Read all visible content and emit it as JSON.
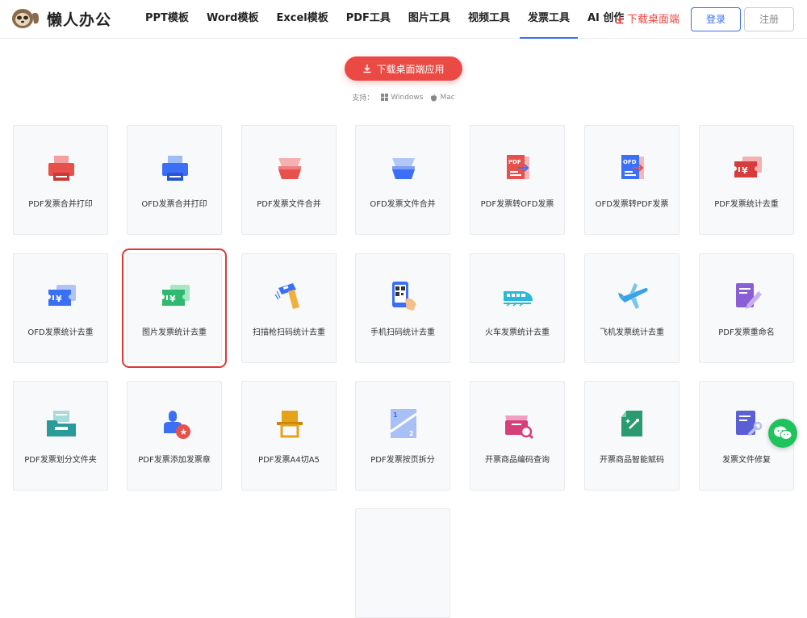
{
  "header": {
    "logo_text": "懒人办公",
    "nav": [
      "PPT模板",
      "Word模板",
      "Excel模板",
      "PDF工具",
      "图片工具",
      "视频工具",
      "发票工具",
      "AI 创作"
    ],
    "active_nav": "发票工具",
    "download_link": "下载桌面端",
    "login": "登录",
    "register": "注册"
  },
  "hero": {
    "download_button": "下载桌面端应用",
    "support_label": "支持：",
    "os": [
      "Windows",
      "Mac"
    ]
  },
  "tools": [
    {
      "label": "PDF发票合并打印",
      "icon": "printer-icon",
      "color": "#e8504b"
    },
    {
      "label": "OFD发票合并打印",
      "icon": "printer-icon",
      "color": "#3b6ff5"
    },
    {
      "label": "PDF发票文件合并",
      "icon": "merge-pages-icon",
      "color": "#e8504b"
    },
    {
      "label": "OFD发票文件合并",
      "icon": "merge-pages-icon",
      "color": "#3b6ff5"
    },
    {
      "label": "PDF发票转OFD发票",
      "icon": "pdf-to-ofd-icon",
      "color": "#e8504b"
    },
    {
      "label": "OFD发票转PDF发票",
      "icon": "ofd-to-pdf-icon",
      "color": "#3b6ff5"
    },
    {
      "label": "PDF发票统计去重",
      "icon": "yen-ticket-icon",
      "color": "#d63c3c"
    },
    {
      "label": "OFD发票统计去重",
      "icon": "yen-ticket-icon",
      "color": "#3b6ff5"
    },
    {
      "label": "图片发票统计去重",
      "icon": "yen-ticket-icon",
      "color": "#2fb86f"
    },
    {
      "label": "扫描枪扫码统计去重",
      "icon": "scanner-gun-icon",
      "color": "#3b6ff5"
    },
    {
      "label": "手机扫码统计去重",
      "icon": "phone-qr-icon",
      "color": "#3b6ff5"
    },
    {
      "label": "火车发票统计去重",
      "icon": "train-icon",
      "color": "#2ab8d8"
    },
    {
      "label": "飞机发票统计去重",
      "icon": "airplane-icon",
      "color": "#3aa3e8"
    },
    {
      "label": "PDF发票重命名",
      "icon": "edit-document-icon",
      "color": "#8a5fd6"
    },
    {
      "label": "PDF发票划分文件夹",
      "icon": "folder-tray-icon",
      "color": "#2a9a9a"
    },
    {
      "label": "PDF发票添加发票章",
      "icon": "stamp-icon",
      "color": "#3b6ff5"
    },
    {
      "label": "PDF发票A4切A5",
      "icon": "cut-page-icon",
      "color": "#e6a21a"
    },
    {
      "label": "PDF发票按页拆分",
      "icon": "split-pages-icon",
      "color": "#3b6ff5"
    },
    {
      "label": "开票商品编码查询",
      "icon": "box-search-icon",
      "color": "#d6407a"
    },
    {
      "label": "开票商品智能赋码",
      "icon": "smart-code-icon",
      "color": "#2a9a70"
    },
    {
      "label": "发票文件修复",
      "icon": "file-repair-icon",
      "color": "#5a5fd6"
    },
    {
      "label": "",
      "icon": "",
      "color": "#f8f9fa"
    }
  ],
  "highlighted_tool": "图片发票统计去重",
  "chat_button": "wechat-icon"
}
